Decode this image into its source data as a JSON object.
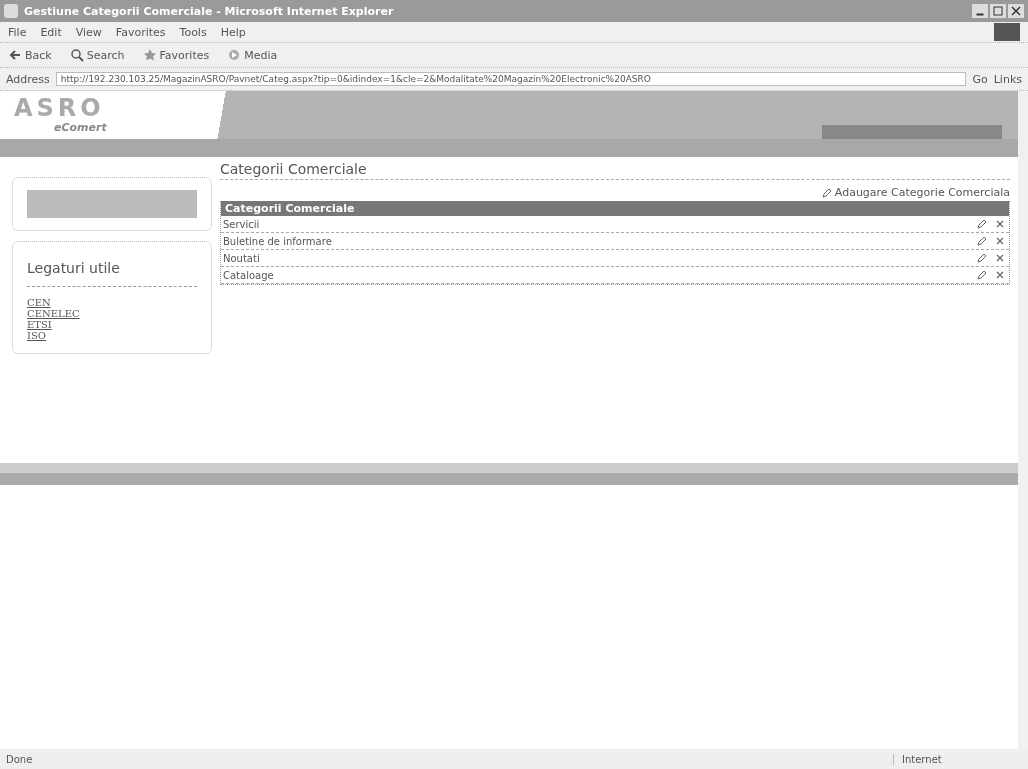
{
  "window": {
    "title": "Gestiune Categorii Comerciale - Microsoft Internet Explorer"
  },
  "menu": [
    "File",
    "Edit",
    "View",
    "Favorites",
    "Tools",
    "Help"
  ],
  "toolbar": [
    {
      "kind": "back",
      "label": "Back"
    },
    {
      "kind": "search",
      "label": "Search"
    },
    {
      "kind": "favorites",
      "label": "Favorites"
    },
    {
      "kind": "media",
      "label": "Media"
    }
  ],
  "address": {
    "label": "Address",
    "value": "http://192.230.103.25/MagazinASRO/Pavnet/Categ.aspx?tip=0&idindex=1&cle=2&Modalitate%20Magazin%20Electronic%20ASRO",
    "go": "Go",
    "links": "Links"
  },
  "site": {
    "logo": "ASRO",
    "logo_sub": "eComert"
  },
  "page": {
    "heading": "Categorii Comerciale",
    "add_link": "Adaugare Categorie Comerciala"
  },
  "sidebar": {
    "title": "Legaturi utile",
    "links": [
      "CEN",
      "CENELEC",
      "ETSI",
      "ISO"
    ]
  },
  "table": {
    "header": "Categorii Comerciale",
    "rows": [
      {
        "name": "Servicii"
      },
      {
        "name": "Buletine de informare"
      },
      {
        "name": "Noutati"
      },
      {
        "name": "Cataloage"
      }
    ]
  },
  "status_bar": {
    "text": "Done",
    "zone": "Internet"
  }
}
